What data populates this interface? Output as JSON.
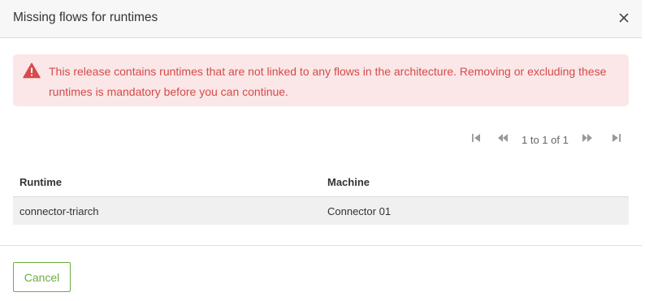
{
  "dialog": {
    "title": "Missing flows for runtimes",
    "close_icon": "close-icon"
  },
  "alert": {
    "icon": "warning-triangle-icon",
    "color": "#d44a4a",
    "background": "#fbe7e7",
    "message": "This release contains runtimes that are not linked to any flows in the architecture. Removing or excluding these runtimes is mandatory before you can continue."
  },
  "pagination": {
    "info": "1 to 1 of 1",
    "icons": [
      "first-page-icon",
      "previous-page-icon",
      "next-page-icon",
      "last-page-icon"
    ]
  },
  "table": {
    "columns": [
      "Runtime",
      "Machine"
    ],
    "rows": [
      [
        "connector-triarch",
        "Connector 01"
      ]
    ]
  },
  "footer": {
    "cancel_label": "Cancel",
    "accent_color": "#6cae3e"
  }
}
